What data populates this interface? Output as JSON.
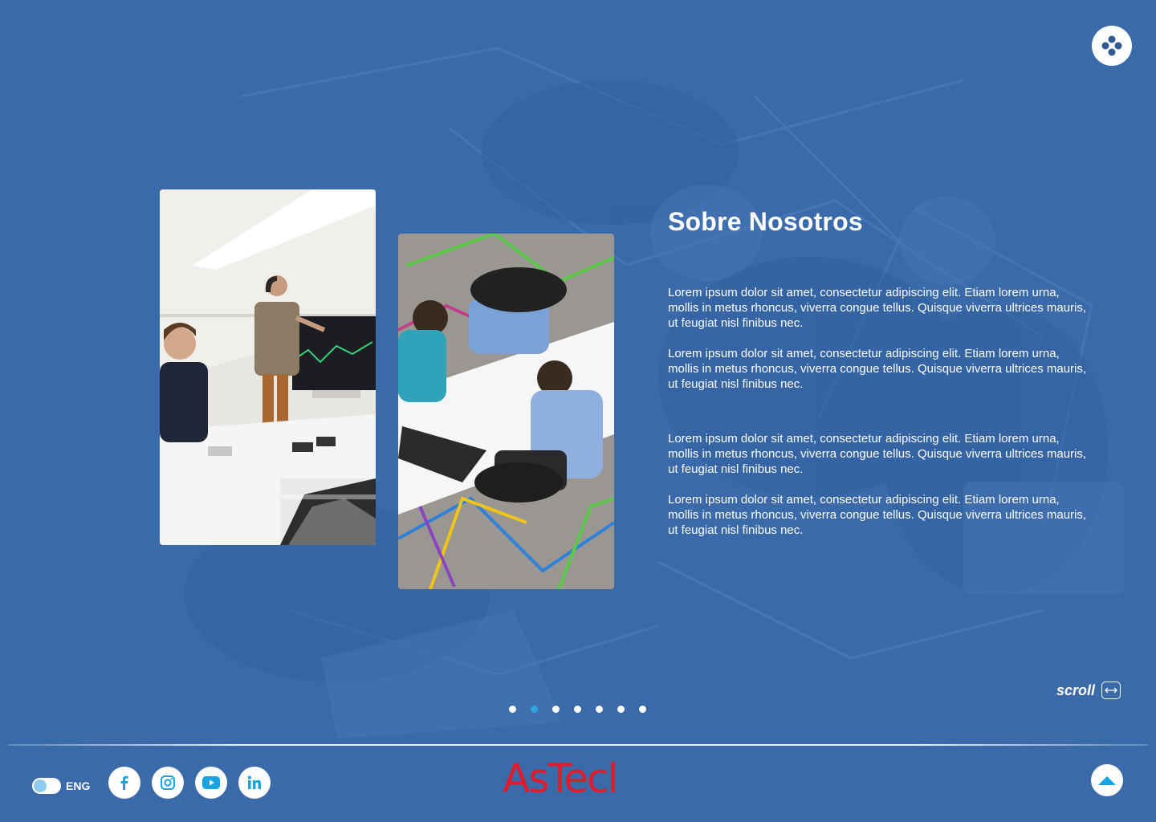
{
  "header": {
    "menu_icon": "grid-dots-icon"
  },
  "about": {
    "title": "Sobre Nosotros",
    "paragraphs": [
      "Lorem ipsum dolor sit amet, consectetur adipiscing elit. Etiam lorem urna, mollis in metus rhoncus, viverra congue tellus. Quisque viverra ultrices mauris, ut feugiat nisl finibus nec.",
      "Lorem ipsum dolor sit amet, consectetur adipiscing elit. Etiam lorem urna, mollis in metus rhoncus, viverra congue tellus. Quisque viverra ultrices mauris, ut feugiat nisl finibus nec.",
      "Lorem ipsum dolor sit amet, consectetur adipiscing elit. Etiam lorem urna, mollis in metus rhoncus, viverra congue tellus. Quisque viverra ultrices mauris, ut feugiat nisl finibus nec.",
      "Lorem ipsum dolor sit amet, consectetur adipiscing elit. Etiam lorem urna, mollis in metus rhoncus, viverra congue tellus. Quisque viverra ultrices mauris, ut feugiat nisl finibus nec."
    ]
  },
  "scroll_hint": {
    "label": "scroll",
    "icon": "horizontal-scroll-icon"
  },
  "pagination": {
    "total": 7,
    "active_index": 1
  },
  "footer": {
    "language": {
      "label": "ENG"
    },
    "social": [
      "facebook-icon",
      "instagram-icon",
      "youtube-icon",
      "linkedin-icon"
    ],
    "logo_text": "AsTecl",
    "back_to_top_icon": "chevron-up-icon"
  },
  "colors": {
    "background": "#3a6aaa",
    "accent": "#2aa6e0",
    "logo": "#e21b2a"
  }
}
